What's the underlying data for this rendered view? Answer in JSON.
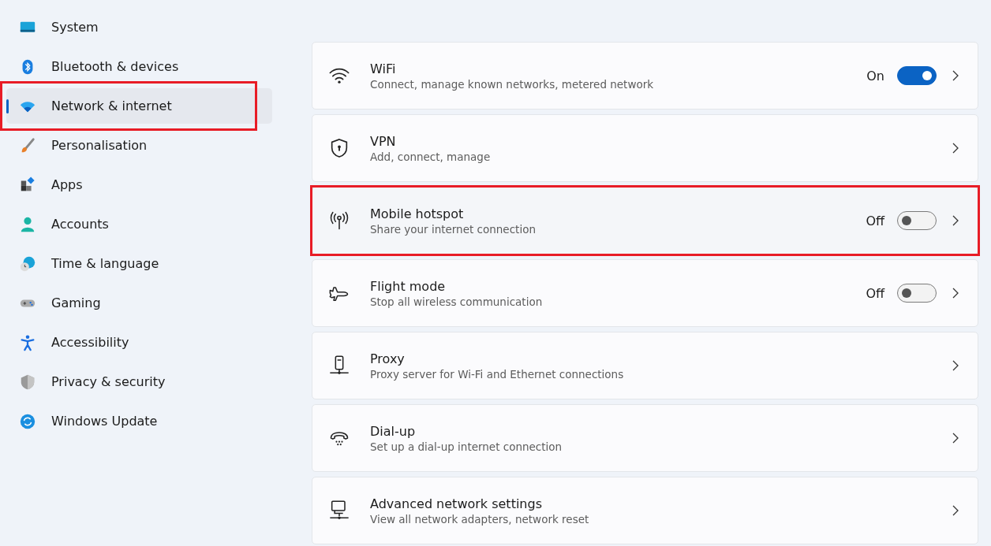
{
  "sidebar": {
    "items": [
      {
        "label": "System",
        "selected": false,
        "highlighted": false
      },
      {
        "label": "Bluetooth & devices",
        "selected": false,
        "highlighted": false
      },
      {
        "label": "Network & internet",
        "selected": true,
        "highlighted": true
      },
      {
        "label": "Personalisation",
        "selected": false,
        "highlighted": false
      },
      {
        "label": "Apps",
        "selected": false,
        "highlighted": false
      },
      {
        "label": "Accounts",
        "selected": false,
        "highlighted": false
      },
      {
        "label": "Time & language",
        "selected": false,
        "highlighted": false
      },
      {
        "label": "Gaming",
        "selected": false,
        "highlighted": false
      },
      {
        "label": "Accessibility",
        "selected": false,
        "highlighted": false
      },
      {
        "label": "Privacy & security",
        "selected": false,
        "highlighted": false
      },
      {
        "label": "Windows Update",
        "selected": false,
        "highlighted": false
      }
    ]
  },
  "settings": [
    {
      "title": "WiFi",
      "description": "Connect, manage known networks, metered network",
      "kind": "toggle",
      "on": true,
      "state_label": "On",
      "highlighted": false
    },
    {
      "title": "VPN",
      "description": "Add, connect, manage",
      "kind": "link",
      "highlighted": false
    },
    {
      "title": "Mobile hotspot",
      "description": "Share your internet connection",
      "kind": "toggle",
      "on": false,
      "state_label": "Off",
      "highlighted": true
    },
    {
      "title": "Flight mode",
      "description": "Stop all wireless communication",
      "kind": "toggle",
      "on": false,
      "state_label": "Off",
      "highlighted": false
    },
    {
      "title": "Proxy",
      "description": "Proxy server for Wi-Fi and Ethernet connections",
      "kind": "link",
      "highlighted": false
    },
    {
      "title": "Dial-up",
      "description": "Set up a dial-up internet connection",
      "kind": "link",
      "highlighted": false
    },
    {
      "title": "Advanced network settings",
      "description": "View all network adapters, network reset",
      "kind": "link",
      "highlighted": false
    }
  ]
}
